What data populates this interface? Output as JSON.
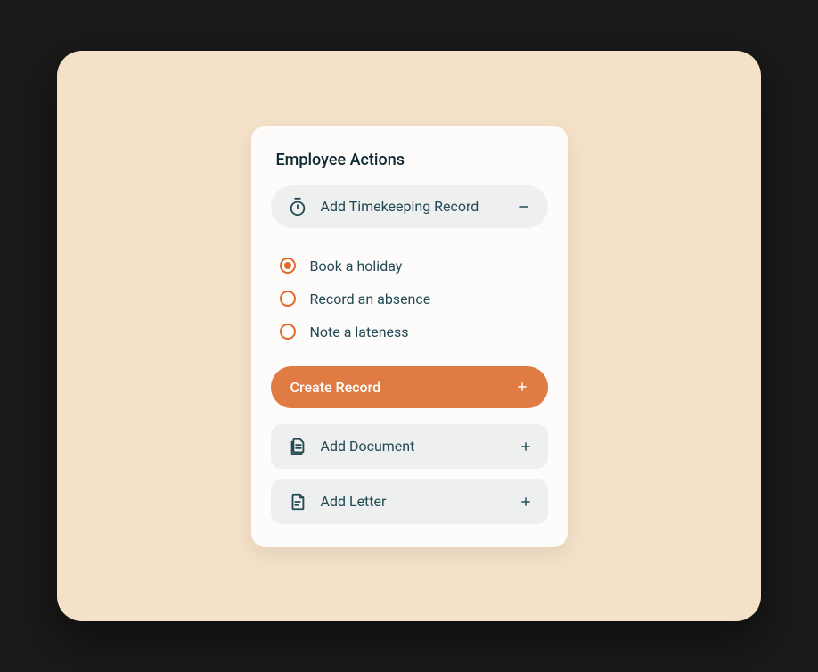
{
  "card": {
    "title": "Employee Actions",
    "timekeeping": {
      "label": "Add Timekeeping Record",
      "expanded": true,
      "options": [
        {
          "label": "Book a holiday",
          "selected": true
        },
        {
          "label": "Record an absence",
          "selected": false
        },
        {
          "label": "Note a lateness",
          "selected": false
        }
      ]
    },
    "cta": {
      "label": "Create Record"
    },
    "add_document": {
      "label": "Add Document"
    },
    "add_letter": {
      "label": "Add Letter"
    }
  },
  "colors": {
    "accent": "#e07b43",
    "text": "#234a54",
    "panel": "#f5e1c8"
  }
}
